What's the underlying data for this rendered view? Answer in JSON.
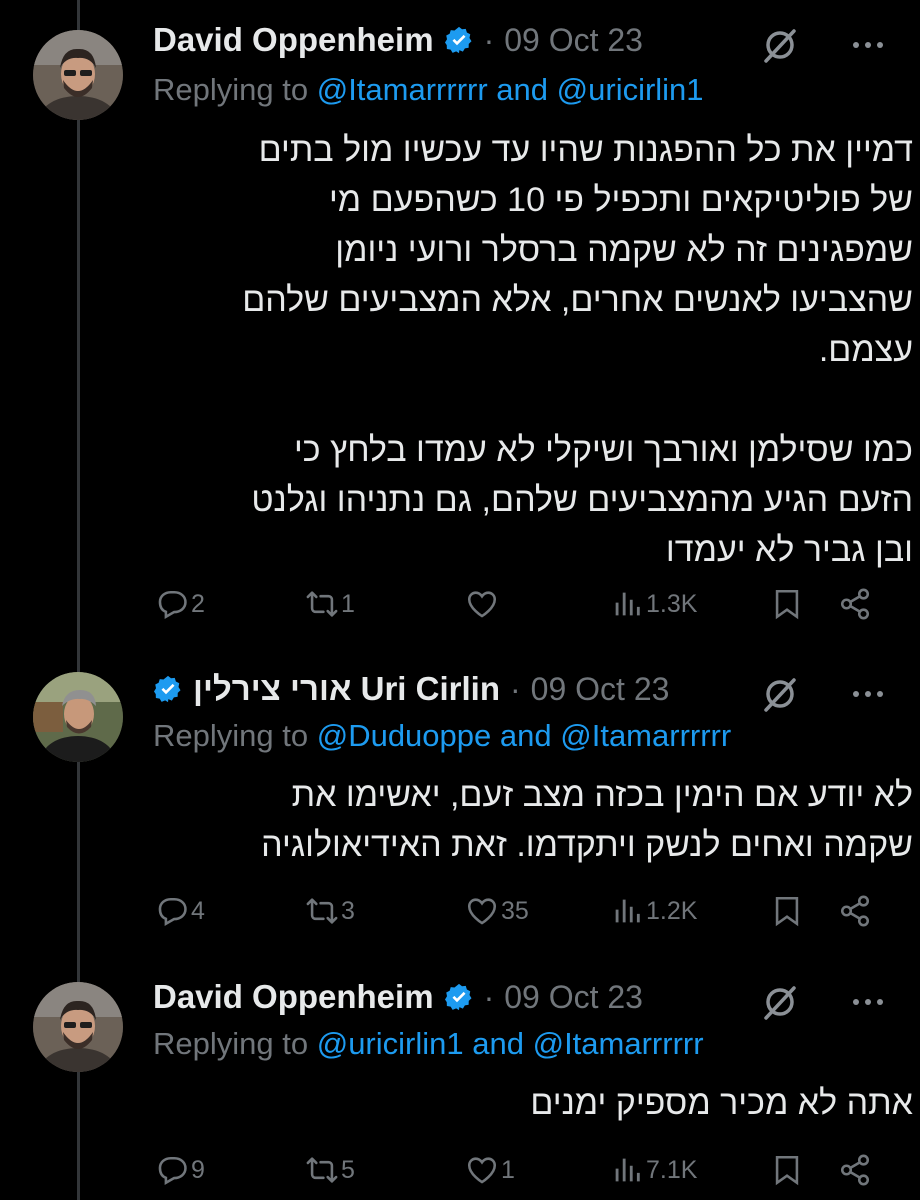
{
  "tweets": [
    {
      "author": "David Oppenheim",
      "verified": true,
      "dot": "·",
      "date": "09 Oct 23",
      "replying_prefix": "Replying to",
      "mention_1": "@Itamarrrrrr",
      "and": "and",
      "mention_2": "@uricirlin1",
      "text": "דמיין את כל ההפגנות שהיו עד עכשיו מול בתים\nשל פוליטיקאים ותכפיל פי 10 כשהפעם מי\nשמפגינים זה לא שקמה ברסלר ורועי ניומן\nשהצביעו לאנשים אחרים, אלא המצביעים שלהם\nעצמם.\n\nכמו שסילמן ואורבך ושיקלי לא עמדו בלחץ כי\nהזעם הגיע מהמצביעים שלהם, גם נתניהו וגלנט\nובן גביר לא יעמדו",
      "replies": "2",
      "reposts": "1",
      "likes": "",
      "views": "1.3K"
    },
    {
      "author": "אורי צירלין Uri Cirlin",
      "verified": true,
      "dot": "·",
      "date": "09 Oct 23",
      "replying_prefix": "Replying to",
      "mention_1": "@Duduoppe",
      "and": "and",
      "mention_2": "@Itamarrrrrr",
      "text": "לא יודע אם הימין בכזה מצב זעם, יאשימו את\nשקמה ואחים לנשק ויתקדמו. זאת האידיאולוגיה",
      "replies": "4",
      "reposts": "3",
      "likes": "35",
      "views": "1.2K"
    },
    {
      "author": "David Oppenheim",
      "verified": true,
      "dot": "·",
      "date": "09 Oct 23",
      "replying_prefix": "Replying to",
      "mention_1": "@uricirlin1",
      "and": "and",
      "mention_2": "@Itamarrrrrr",
      "text": "אתה לא מכיר מספיק ימנים",
      "replies": "9",
      "reposts": "5",
      "likes": "1",
      "views": "7.1K"
    }
  ],
  "icons": {
    "reply": "reply-icon",
    "repost": "repost-icon",
    "like": "heart-icon",
    "views": "views-icon",
    "bookmark": "bookmark-icon",
    "share": "share-icon",
    "grok": "grok-icon",
    "more": "more-icon",
    "verified": "verified-badge-icon"
  },
  "colors": {
    "background": "#000000",
    "text": "#e7e9ea",
    "muted": "#71767b",
    "accent": "#1d9bf0"
  }
}
